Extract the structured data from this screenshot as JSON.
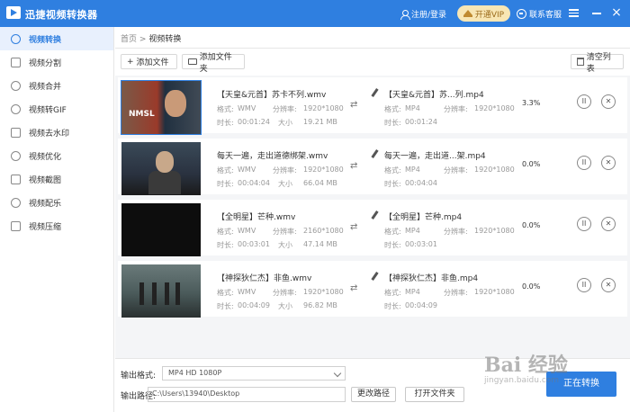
{
  "app": {
    "title": "迅捷视频转换器"
  },
  "header": {
    "login_label": "注册/登录",
    "vip_label": "开通VIP",
    "support_label": "联系客服"
  },
  "sidebar": {
    "items": [
      {
        "label": "视频转换",
        "icon": "convert-icon",
        "active": true
      },
      {
        "label": "视频分割",
        "icon": "split-icon"
      },
      {
        "label": "视频合并",
        "icon": "merge-icon"
      },
      {
        "label": "视频转GIF",
        "icon": "gif-icon"
      },
      {
        "label": "视频去水印",
        "icon": "watermark-remove-icon"
      },
      {
        "label": "视频优化",
        "icon": "optimize-icon"
      },
      {
        "label": "视频截图",
        "icon": "screenshot-icon"
      },
      {
        "label": "视频配乐",
        "icon": "music-icon"
      },
      {
        "label": "视频压缩",
        "icon": "compress-icon"
      }
    ]
  },
  "breadcrumb": {
    "home": "首页",
    "sep": ">",
    "current": "视频转换"
  },
  "toolbar": {
    "add_file": "添加文件",
    "add_folder": "添加文件夹",
    "clear_list": "清空列表"
  },
  "files": [
    {
      "src_name": "【天皇&元首】苏卡不列.wmv",
      "dst_name": "【天皇&元首】苏...列.mp4",
      "thumb_label": "NMSL",
      "src_format_label": "格式:",
      "src_format": "WMV",
      "src_res_label": "分辨率:",
      "src_res": "1920*1080",
      "src_duration_label": "时长:",
      "src_duration": "00:01:24",
      "src_size_label": "大小",
      "src_size": "19.21 MB",
      "dst_format_label": "格式:",
      "dst_format": "MP4",
      "dst_res_label": "分辨率:",
      "dst_res": "1920*1080",
      "dst_duration_label": "时长:",
      "dst_duration": "00:01:24",
      "progress": "3.3%"
    },
    {
      "src_name": "每天一遍，走出道德绑架.wmv",
      "dst_name": "每天一遍，走出道...架.mp4",
      "thumb_label": "",
      "src_format_label": "格式:",
      "src_format": "WMV",
      "src_res_label": "分辨率:",
      "src_res": "1920*1080",
      "src_duration_label": "时长:",
      "src_duration": "00:04:04",
      "src_size_label": "大小",
      "src_size": "66.04 MB",
      "dst_format_label": "格式:",
      "dst_format": "MP4",
      "dst_res_label": "分辨率:",
      "dst_res": "1920*1080",
      "dst_duration_label": "时长:",
      "dst_duration": "00:04:04",
      "progress": "0.0%"
    },
    {
      "src_name": "【全明星】芒种.wmv",
      "dst_name": "【全明星】芒种.mp4",
      "thumb_label": "",
      "src_format_label": "格式:",
      "src_format": "WMV",
      "src_res_label": "分辨率:",
      "src_res": "2160*1080",
      "src_duration_label": "时长:",
      "src_duration": "00:03:01",
      "src_size_label": "大小",
      "src_size": "47.14 MB",
      "dst_format_label": "格式:",
      "dst_format": "MP4",
      "dst_res_label": "分辨率:",
      "dst_res": "1920*1080",
      "dst_duration_label": "时长:",
      "dst_duration": "00:03:01",
      "progress": "0.0%"
    },
    {
      "src_name": "【神探狄仁杰】非鱼.wmv",
      "dst_name": "【神探狄仁杰】非鱼.mp4",
      "thumb_label": "",
      "src_format_label": "格式:",
      "src_format": "WMV",
      "src_res_label": "分辨率:",
      "src_res": "1920*1080",
      "src_duration_label": "时长:",
      "src_duration": "00:04:09",
      "src_size_label": "大小",
      "src_size": "96.82 MB",
      "dst_format_label": "格式:",
      "dst_format": "MP4",
      "dst_res_label": "分辨率:",
      "dst_res": "1920*1080",
      "dst_duration_label": "时长:",
      "dst_duration": "00:04:09",
      "progress": "0.0%"
    }
  ],
  "output": {
    "format_label": "输出格式:",
    "format_value": "MP4   HD 1080P",
    "path_label": "输出路径:",
    "path_value": "C:\\Users\\13940\\Desktop",
    "change_path": "更改路径",
    "open_folder": "打开文件夹",
    "convert": "正在转换"
  },
  "watermark": {
    "text": "Bai 经验",
    "sub": "jingyan.baidu.com"
  },
  "colors": {
    "accent": "#2f7fe0",
    "vip_bg": "#f8e6b4"
  }
}
